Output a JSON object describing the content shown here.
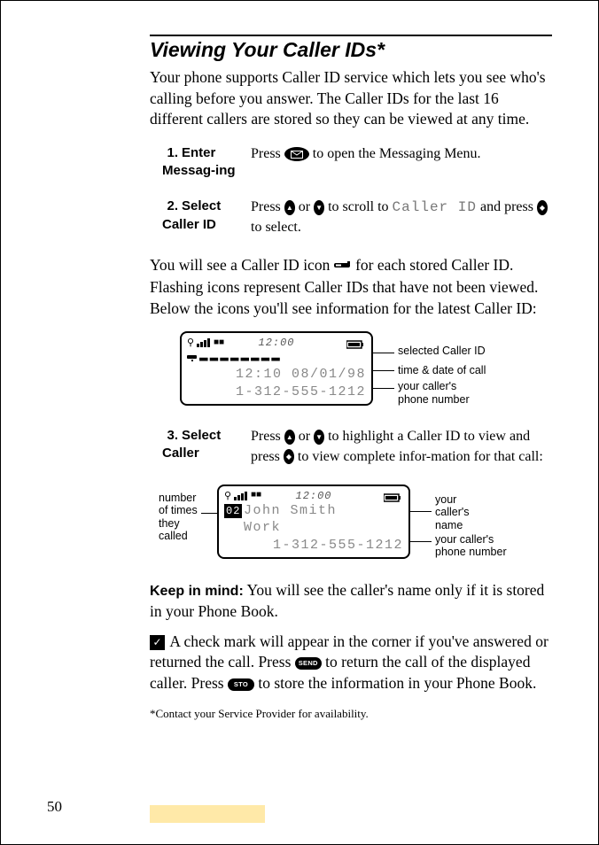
{
  "page_number": "50",
  "title": "Viewing Your Caller IDs*",
  "intro": "Your phone supports Caller ID service which lets you see who's calling before you answer. The Caller IDs for the last 16 different callers are stored so they can be viewed at any time.",
  "steps": [
    {
      "num": "1.",
      "label": "Enter Messag-ing",
      "body_pre": "Press ",
      "body_post": " to open the Messaging Menu."
    },
    {
      "num": "2.",
      "label": "Select Caller ID",
      "body_a": "Press ",
      "body_b": " or ",
      "body_c": " to scroll to ",
      "mono": "Caller ID",
      "body_d": " and press ",
      "body_e": " to select."
    }
  ],
  "mid_para_a": "You will see a Caller ID icon ",
  "mid_para_b": " for each stored Caller ID. Flashing icons represent Caller IDs that have not been viewed. Below the icons you'll see information for the latest Caller ID:",
  "screen1": {
    "clock": "12:00",
    "line1": "12:10 08/01/98",
    "line2": "1-312-555-1212"
  },
  "annot1": {
    "a": "selected Caller ID",
    "b": "time & date of call",
    "c1": "your caller's",
    "c2": "phone number"
  },
  "step3": {
    "num": "3.",
    "label": "Select Caller",
    "body_a": "Press ",
    "body_b": " or ",
    "body_c": " to highlight a Caller ID to view and press ",
    "body_d": " to view complete infor-mation for that call:"
  },
  "screen2": {
    "clock": "12:00",
    "count": "02",
    "name1": "John Smith",
    "name2": "Work",
    "phone": "1-312-555-1212"
  },
  "annot2": {
    "left1": "number",
    "left2": "of times",
    "left3": "they",
    "left4": "called",
    "r1a": "your",
    "r1b": "caller's",
    "r1c": "name",
    "r2a": "your caller's",
    "r2b": "phone number"
  },
  "keep_label": "Keep in mind:",
  "keep_text": " You will see the caller's name only if it is stored in your Phone Book.",
  "check_para_a": " A check mark will appear in the corner if you've answered or returned the call. Press ",
  "check_para_b": " to return the call of the displayed caller. Press ",
  "check_para_c": " to store the information in your Phone Book.",
  "btn_send": "SEND",
  "btn_sto": "STO",
  "footnote": "*Contact your Service Provider for availability."
}
